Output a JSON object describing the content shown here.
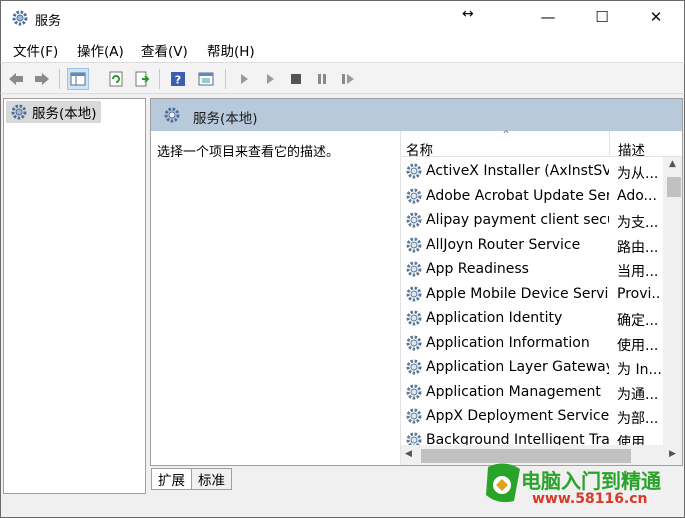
{
  "window": {
    "title": "服务",
    "resize_glyph": "↔",
    "minimize_glyph": "—",
    "maximize_glyph": "☐",
    "close_glyph": "✕"
  },
  "menu": {
    "items": [
      "文件(F)",
      "操作(A)",
      "查看(V)",
      "帮助(H)"
    ]
  },
  "toolbar": {
    "icons": [
      "back-icon",
      "forward-icon",
      "show-tree-icon",
      "refresh-icon",
      "export-list-icon",
      "help-icon",
      "properties-icon",
      "start-service-icon",
      "start-alt-icon",
      "stop-service-icon",
      "pause-service-icon",
      "restart-service-icon"
    ]
  },
  "tree": {
    "root_label": "服务(本地)"
  },
  "detail": {
    "header_title": "服务(本地)",
    "description_hint": "选择一个项目来查看它的描述。"
  },
  "list": {
    "columns": {
      "name": "名称",
      "description": "描述"
    },
    "sort_glyph": "⌃",
    "rows": [
      {
        "name": "ActiveX Installer (AxInstSV)",
        "desc": "为从..."
      },
      {
        "name": "Adobe Acrobat Update Ser...",
        "desc": "Ado..."
      },
      {
        "name": "Alipay payment client secu...",
        "desc": "为支..."
      },
      {
        "name": "AllJoyn Router Service",
        "desc": "路由..."
      },
      {
        "name": "App Readiness",
        "desc": "当用..."
      },
      {
        "name": "Apple Mobile Device Servi...",
        "desc": "Provi..."
      },
      {
        "name": "Application Identity",
        "desc": "确定..."
      },
      {
        "name": "Application Information",
        "desc": "使用..."
      },
      {
        "name": "Application Layer Gateway ...",
        "desc": "为 In..."
      },
      {
        "name": "Application Management",
        "desc": "为通..."
      },
      {
        "name": "AppX Deployment Service ...",
        "desc": "为部..."
      },
      {
        "name": "Background Intelligent Tra...",
        "desc": "使用..."
      }
    ]
  },
  "tabs": {
    "extended": "扩展",
    "standard": "标准"
  },
  "watermark": {
    "name": "电脑入门到精通",
    "url": "www.58116.cn"
  },
  "colors": {
    "header_band": "#b8c9dc",
    "selection": "#d9d9d9",
    "watermark_green": "#2aa32a",
    "watermark_red": "#d63a2a"
  }
}
